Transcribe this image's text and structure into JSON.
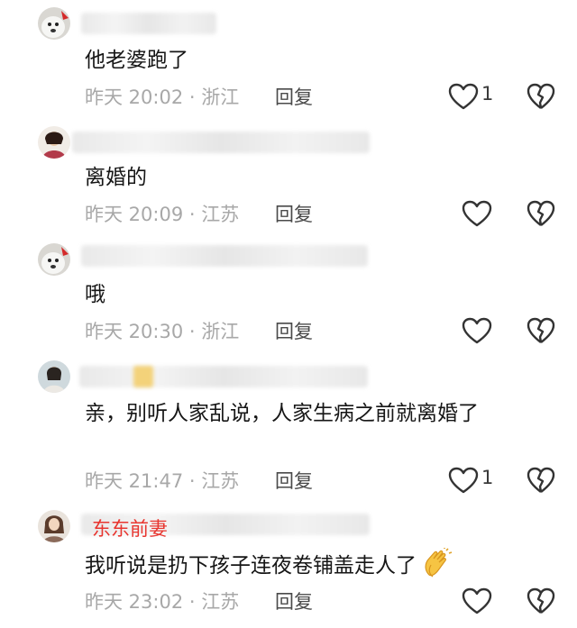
{
  "comments": [
    {
      "text": "他老婆跑了",
      "meta": "昨天 20:02 · 浙江",
      "reply": "回复",
      "likes": "1"
    },
    {
      "text": "离婚的",
      "meta": "昨天 20:09 · 江苏",
      "reply": "回复",
      "likes": ""
    },
    {
      "text": "哦",
      "meta": "昨天 20:30 · 浙江",
      "reply": "回复",
      "likes": ""
    },
    {
      "text": "亲，别听人家乱说，人家生病之前就离婚了",
      "meta": "昨天 21:47 · 江苏",
      "reply": "回复",
      "likes": "1"
    },
    {
      "name": "东东前妻",
      "text": "我听说是扔下孩子连夜卷铺盖走人了",
      "meta": "昨天 23:02 · 江苏",
      "reply": "回复",
      "likes": ""
    }
  ],
  "colors": {
    "annotation_red": "#e8352f",
    "meta_gray": "#a8a8a8",
    "text": "#161616"
  },
  "icons": [
    "heart-outline-icon",
    "broken-heart-icon",
    "clapping-hands-emoji"
  ]
}
